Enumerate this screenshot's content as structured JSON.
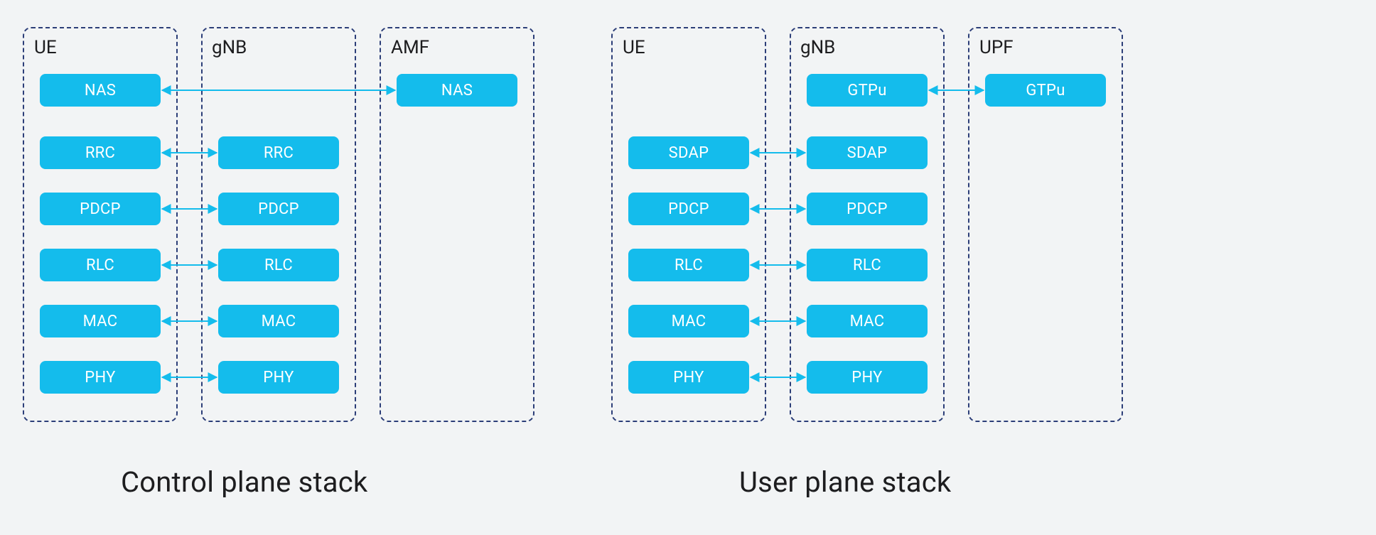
{
  "colors": {
    "accent": "#14bcec",
    "dash": "#2c3e78",
    "bg": "#f2f4f5"
  },
  "control": {
    "caption": "Control plane stack",
    "ue_title": "UE",
    "gnb_title": "gNB",
    "amf_title": "AMF",
    "ue_layers": [
      "NAS",
      "RRC",
      "PDCP",
      "RLC",
      "MAC",
      "PHY"
    ],
    "gnb_layers": [
      "RRC",
      "PDCP",
      "RLC",
      "MAC",
      "PHY"
    ],
    "amf_layers": [
      "NAS"
    ]
  },
  "user": {
    "caption": "User plane stack",
    "ue_title": "UE",
    "gnb_title": "gNB",
    "upf_title": "UPF",
    "ue_layers": [
      "SDAP",
      "PDCP",
      "RLC",
      "MAC",
      "PHY"
    ],
    "gnb_layers": [
      "GTPu",
      "SDAP",
      "PDCP",
      "RLC",
      "MAC",
      "PHY"
    ],
    "upf_layers": [
      "GTPu"
    ]
  }
}
